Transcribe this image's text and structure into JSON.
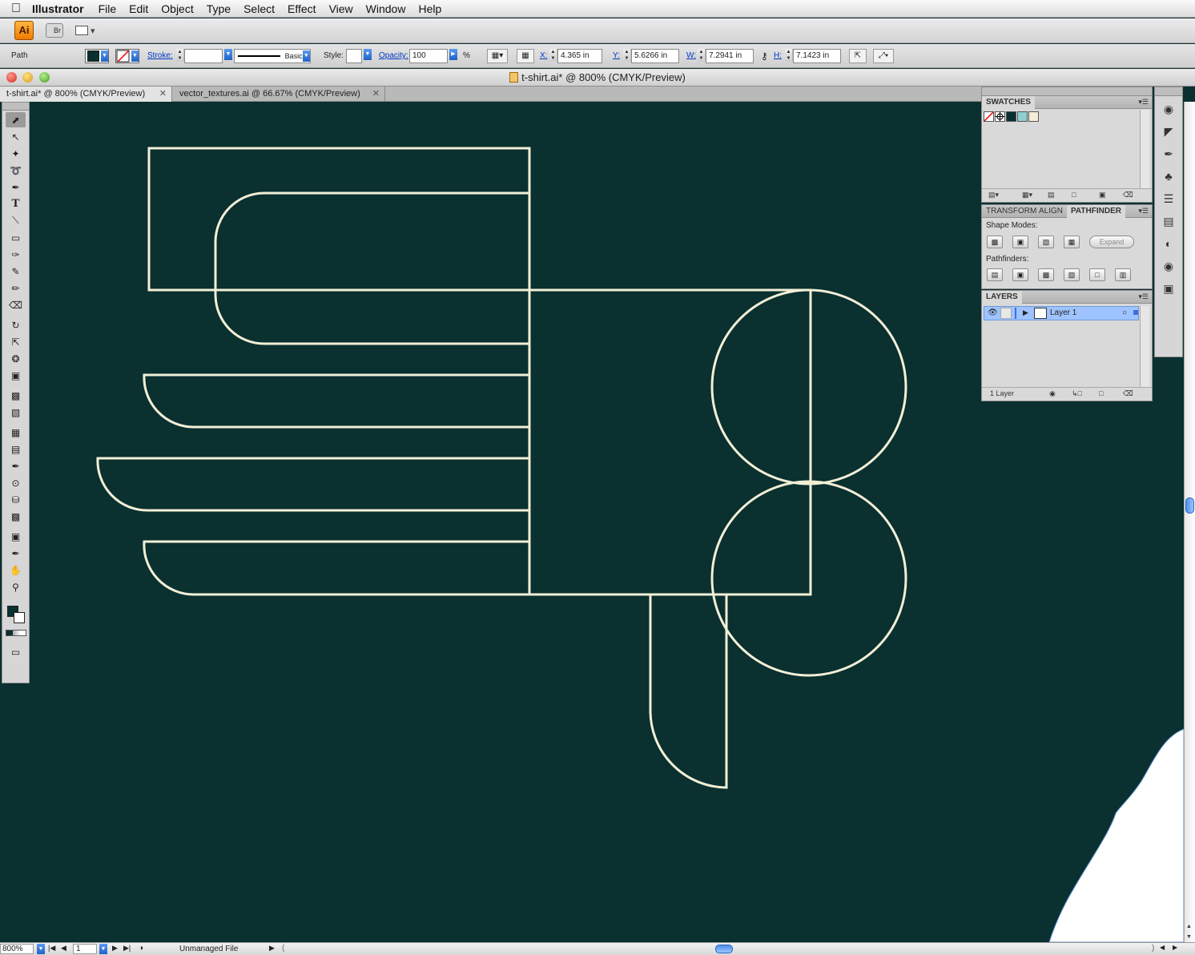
{
  "menubar": {
    "app_name": "Illustrator",
    "items": [
      "File",
      "Edit",
      "Object",
      "Type",
      "Select",
      "Effect",
      "View",
      "Window",
      "Help"
    ]
  },
  "appbar": {
    "ai_label": "Ai",
    "bridge_label": "Br"
  },
  "control": {
    "selection_type": "Path",
    "stroke_label": "Stroke:",
    "stroke_profile": "Basic",
    "style_label": "Style:",
    "opacity_label": "Opacity:",
    "opacity_value": "100",
    "opacity_unit": "%",
    "x_label": "X:",
    "x_value": "4.365 in",
    "y_label": "Y:",
    "y_value": "5.6266 in",
    "w_label": "W:",
    "w_value": "7.2941 in",
    "h_label": "H:",
    "h_value": "7.1423 in"
  },
  "window": {
    "title": "t-shirt.ai* @ 800% (CMYK/Preview)"
  },
  "tabs": [
    {
      "label": "t-shirt.ai* @ 800% (CMYK/Preview)",
      "active": true
    },
    {
      "label": "vector_textures.ai @ 66.67% (CMYK/Preview)",
      "active": false
    }
  ],
  "canvas": {
    "background": "#0a3030",
    "stroke_color": "#f2efd6"
  },
  "swatches_panel": {
    "title": "SWATCHES",
    "colors": [
      "#0a3030",
      "#8ecfcf",
      "#f2efd6"
    ]
  },
  "transform_panel": {
    "tabs": [
      "TRANSFORM",
      "ALIGN",
      "PATHFINDER"
    ],
    "shape_modes_label": "Shape Modes:",
    "expand_label": "Expand",
    "pathfinders_label": "Pathfinders:"
  },
  "layers_panel": {
    "title": "LAYERS",
    "layer_name": "Layer 1",
    "count_label": "1 Layer"
  },
  "status": {
    "zoom": "800%",
    "artboard": "1",
    "file_status": "Unmanaged File"
  }
}
